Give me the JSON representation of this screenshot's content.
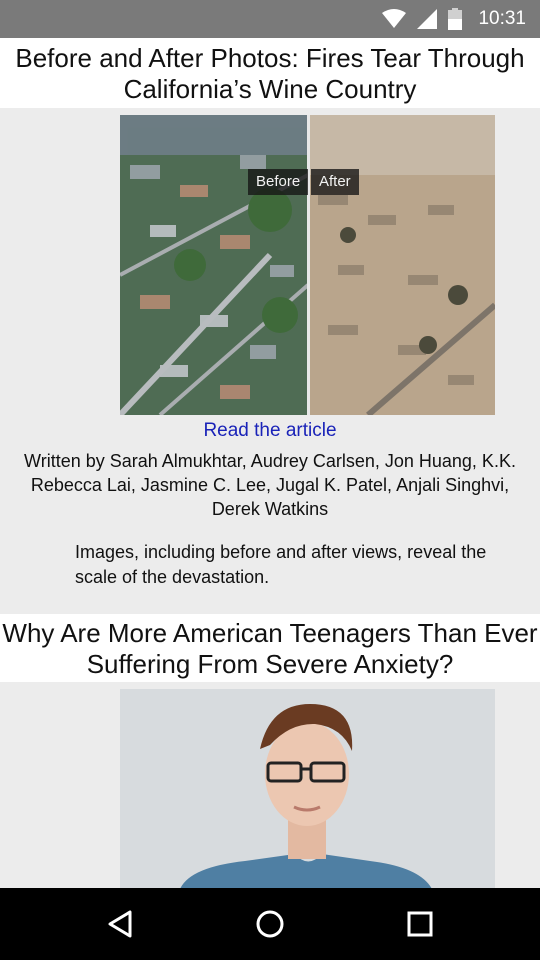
{
  "status": {
    "time": "10:31",
    "wifi_icon": "wifi-icon",
    "signal_icon": "signal-icon",
    "battery_icon": "battery-icon"
  },
  "article1": {
    "title": "Before and After Photos: Fires Tear Through California’s Wine Country",
    "label_before": "Before",
    "label_after": "After",
    "link": "Read the article",
    "byline": "Written by Sarah Almukhtar, Audrey Carlsen, Jon Huang, K.K. Rebecca Lai, Jasmine C. Lee, Jugal K. Patel, Anjali Singhvi, Derek Watkins",
    "description": "Images, including before and after views, reveal the scale of the devastation."
  },
  "article2": {
    "title": "Why Are More American Teenagers Than Ever Suffering From Severe Anxiety?"
  },
  "navbar": {
    "back_icon": "back-icon",
    "home_icon": "home-icon",
    "recents_icon": "recents-icon"
  },
  "colors": {
    "status_bar": "#7a7a7a",
    "link": "#1a23b8",
    "nav_bar": "#000000",
    "page_bg": "#ececec"
  }
}
